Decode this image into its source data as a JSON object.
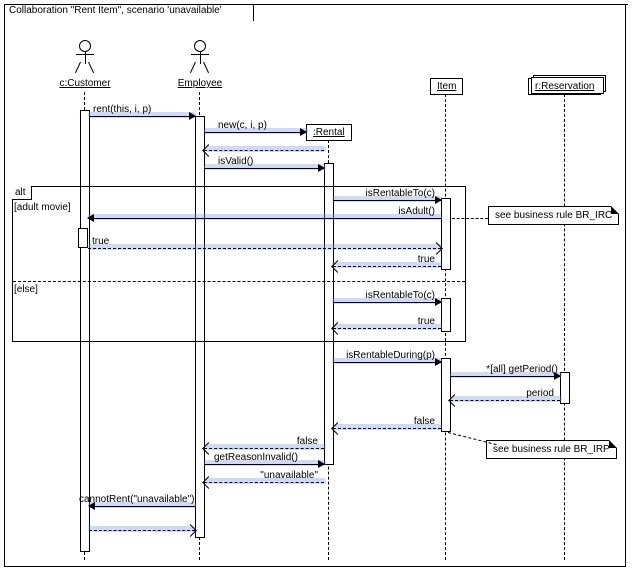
{
  "diagram": {
    "title": "Collaboration \"Rent Item\", scenario 'unavailable'",
    "type": "UML sequence diagram"
  },
  "participants": {
    "customer": {
      "label": "c:Customer",
      "kind": "actor"
    },
    "employee": {
      "label": "Employee",
      "kind": "actor"
    },
    "rental": {
      "label": ":Rental",
      "kind": "object"
    },
    "item": {
      "label": "Item",
      "kind": "object"
    },
    "reservation": {
      "label": "r:Reservation",
      "kind": "object-collection"
    }
  },
  "fragments": {
    "alt": {
      "operator": "alt",
      "guard1": "[adult movie]",
      "guard2": "[else]"
    }
  },
  "messages": {
    "m1": {
      "from": "customer",
      "to": "employee",
      "label": "rent(this, i, p)"
    },
    "m2": {
      "from": "employee",
      "to": "rental",
      "label": "new(c, i, p)",
      "create": true
    },
    "m2r": {
      "from": "rental",
      "to": "employee",
      "label": "",
      "return": true
    },
    "m3": {
      "from": "employee",
      "to": "rental",
      "label": "isValid()"
    },
    "m4": {
      "from": "rental",
      "to": "item",
      "label": "isRentableTo(c)"
    },
    "m5": {
      "from": "item",
      "to": "customer",
      "label": "isAdult()"
    },
    "m5r": {
      "from": "customer",
      "to": "item",
      "label": "true",
      "return": true
    },
    "m4r": {
      "from": "item",
      "to": "rental",
      "label": "true",
      "return": true
    },
    "m6": {
      "from": "rental",
      "to": "item",
      "label": "isRentableTo(c)"
    },
    "m6r": {
      "from": "item",
      "to": "rental",
      "label": "true",
      "return": true
    },
    "m7": {
      "from": "rental",
      "to": "item",
      "label": "isRentableDuring(p)"
    },
    "m8": {
      "from": "item",
      "to": "reservation",
      "label": "*[all] getPeriod()"
    },
    "m8r": {
      "from": "reservation",
      "to": "item",
      "label": "period",
      "return": true
    },
    "m7r": {
      "from": "item",
      "to": "rental",
      "label": "false",
      "return": true
    },
    "m3r": {
      "from": "rental",
      "to": "employee",
      "label": "false",
      "return": true
    },
    "m9": {
      "from": "employee",
      "to": "rental",
      "label": "getReasonInvalid()"
    },
    "m9r": {
      "from": "rental",
      "to": "employee",
      "label": "\"unavailable\"",
      "return": true
    },
    "m10": {
      "from": "employee",
      "to": "customer",
      "label": "cannotRent(\"unavailable\")"
    },
    "m10r": {
      "from": "customer",
      "to": "employee",
      "label": "",
      "return": true
    }
  },
  "notes": {
    "n1": {
      "text": "see business rule BR_IRC",
      "anchor": "m5"
    },
    "n2": {
      "text": "see business rule BR_IRP",
      "anchor": "m7r"
    }
  },
  "chart_data": {
    "type": "sequence-diagram",
    "lifelines": [
      "c:Customer",
      "Employee",
      ":Rental",
      "Item",
      "r:Reservation"
    ],
    "interactions": [
      {
        "from": "c:Customer",
        "to": "Employee",
        "msg": "rent(this, i, p)",
        "kind": "sync"
      },
      {
        "from": "Employee",
        "to": ":Rental",
        "msg": "new(c, i, p)",
        "kind": "create"
      },
      {
        "from": ":Rental",
        "to": "Employee",
        "msg": "",
        "kind": "return"
      },
      {
        "from": "Employee",
        "to": ":Rental",
        "msg": "isValid()",
        "kind": "sync"
      },
      {
        "fragment": "alt",
        "guard": "[adult movie]",
        "msgs": [
          {
            "from": ":Rental",
            "to": "Item",
            "msg": "isRentableTo(c)",
            "kind": "sync"
          },
          {
            "from": "Item",
            "to": "c:Customer",
            "msg": "isAdult()",
            "kind": "sync",
            "note": "see business rule BR_IRC"
          },
          {
            "from": "c:Customer",
            "to": "Item",
            "msg": "true",
            "kind": "return"
          },
          {
            "from": "Item",
            "to": ":Rental",
            "msg": "true",
            "kind": "return"
          }
        ]
      },
      {
        "fragment": "alt",
        "guard": "[else]",
        "msgs": [
          {
            "from": ":Rental",
            "to": "Item",
            "msg": "isRentableTo(c)",
            "kind": "sync"
          },
          {
            "from": "Item",
            "to": ":Rental",
            "msg": "true",
            "kind": "return"
          }
        ]
      },
      {
        "from": ":Rental",
        "to": "Item",
        "msg": "isRentableDuring(p)",
        "kind": "sync"
      },
      {
        "from": "Item",
        "to": "r:Reservation",
        "msg": "*[all] getPeriod()",
        "kind": "sync"
      },
      {
        "from": "r:Reservation",
        "to": "Item",
        "msg": "period",
        "kind": "return"
      },
      {
        "from": "Item",
        "to": ":Rental",
        "msg": "false",
        "kind": "return",
        "note": "see business rule BR_IRP"
      },
      {
        "from": ":Rental",
        "to": "Employee",
        "msg": "false",
        "kind": "return"
      },
      {
        "from": "Employee",
        "to": ":Rental",
        "msg": "getReasonInvalid()",
        "kind": "sync"
      },
      {
        "from": ":Rental",
        "to": "Employee",
        "msg": "\"unavailable\"",
        "kind": "return"
      },
      {
        "from": "Employee",
        "to": "c:Customer",
        "msg": "cannotRent(\"unavailable\")",
        "kind": "sync"
      },
      {
        "from": "c:Customer",
        "to": "Employee",
        "msg": "",
        "kind": "return"
      }
    ]
  }
}
